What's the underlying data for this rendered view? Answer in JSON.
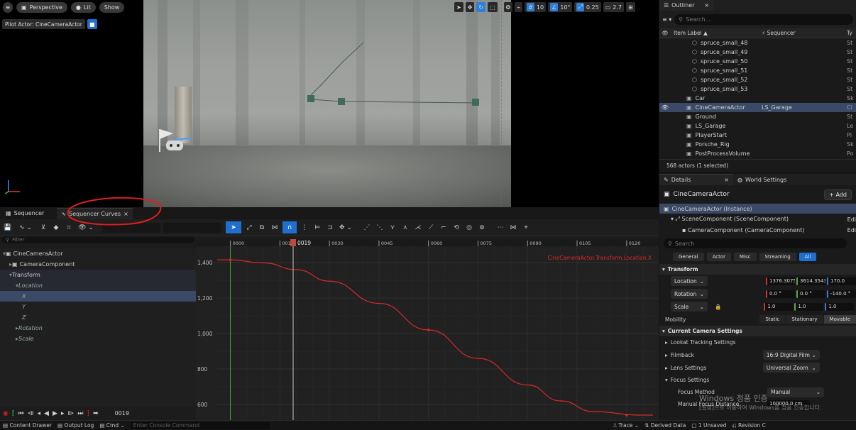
{
  "viewport": {
    "perspective_label": "Perspective",
    "lit_label": "Lit",
    "show_label": "Show",
    "pilot_label": "Pilot Actor: CineCameraActor",
    "grid_snap": "10",
    "rot_snap": "10°",
    "scale_snap": "0.25",
    "camera_speed": "2.7"
  },
  "outliner": {
    "tab_label": "Outliner",
    "search_placeholder": "Search...",
    "col_item_label": "Item Label ▲",
    "col_sequencer": "Sequencer",
    "col_type": "Ty",
    "items": [
      {
        "label": "spruce_small_48",
        "seq": "",
        "type": "St"
      },
      {
        "label": "spruce_small_49",
        "seq": "",
        "type": "St"
      },
      {
        "label": "spruce_small_50",
        "seq": "",
        "type": "St"
      },
      {
        "label": "spruce_small_51",
        "seq": "",
        "type": "St"
      },
      {
        "label": "spruce_small_52",
        "seq": "",
        "type": "St"
      },
      {
        "label": "spruce_small_53",
        "seq": "",
        "type": "St"
      },
      {
        "label": "Car",
        "seq": "",
        "type": "Sk"
      },
      {
        "label": "CineCameraActor",
        "seq": "LS_Garage",
        "type": "Ci"
      },
      {
        "label": "Ground",
        "seq": "",
        "type": "St"
      },
      {
        "label": "LS_Garage",
        "seq": "",
        "type": "Le"
      },
      {
        "label": "PlayerStart",
        "seq": "",
        "type": "Pl"
      },
      {
        "label": "Porsche_Rig",
        "seq": "",
        "type": "Sk"
      },
      {
        "label": "PostProcessVolume",
        "seq": "",
        "type": "Po"
      }
    ],
    "footer": "568 actors (1 selected)"
  },
  "details": {
    "tab_label": "Details",
    "world_settings_label": "World Settings",
    "actor_name": "CineCameraActor",
    "add_label": "+ Add",
    "instance_label": "CineCameraActor (Instance)",
    "scene_component": "SceneComponent (SceneComponent)",
    "camera_component": "CameraComponent (CameraComponent)",
    "edit_label": "Edi",
    "search_placeholder": "Search",
    "filters": [
      "General",
      "Actor",
      "Misc",
      "Streaming",
      "All"
    ],
    "transform_section": "Transform",
    "location_label": "Location",
    "location_values": [
      "1376.3075",
      "3614.3543",
      "170.0"
    ],
    "rotation_label": "Rotation",
    "rotation_values": [
      "0.0 °",
      "0.0 °",
      "-140.0 °"
    ],
    "scale_label": "Scale",
    "scale_values": [
      "1.0",
      "1.0",
      "1.0"
    ],
    "mobility_label": "Mobility",
    "mobility_options": [
      "Static",
      "Stationary",
      "Movable"
    ],
    "camera_section": "Current Camera Settings",
    "lookat": "Lookat Tracking Settings",
    "filmback_label": "Filmback",
    "filmback_value": "16:9 Digital Film",
    "lens_label": "Lens Settings",
    "lens_value": "Universal Zoom",
    "focus_section": "Focus Settings",
    "focus_method_label": "Focus Method",
    "focus_method_value": "Manual",
    "manual_focus_label": "Manual Focus Distance",
    "manual_focus_value": "100000.0 cm",
    "watermark_line1": "Windows 정품 인증",
    "watermark_line2": "[설정]으로 이동하여 Windows를 정품 인증합니다."
  },
  "sequencer": {
    "tab1": "Sequencer",
    "tab2": "Sequencer Curves",
    "filter_placeholder": "Filter",
    "tracks": [
      {
        "label": "CineCameraActor",
        "indent": 0,
        "selected": false
      },
      {
        "label": "CameraComponent",
        "indent": 1,
        "selected": false
      },
      {
        "label": "Transform",
        "indent": 1,
        "selected": false
      },
      {
        "label": "Location",
        "indent": 2,
        "selected": false
      },
      {
        "label": "X",
        "indent": 3,
        "selected": true
      },
      {
        "label": "Y",
        "indent": 3,
        "selected": false
      },
      {
        "label": "Z",
        "indent": 3,
        "selected": false
      },
      {
        "label": "Rotation",
        "indent": 2,
        "selected": false
      },
      {
        "label": "Scale",
        "indent": 2,
        "selected": false
      }
    ],
    "ruler_ticks": [
      "0000",
      "0015",
      "0030",
      "0045",
      "0060",
      "0075",
      "0090",
      "0105",
      "0120"
    ],
    "current_frame": "0019",
    "frame_display": "0019",
    "curve_name": "CineCameraActor.Transform.Location.X",
    "y_ticks": [
      "1,400",
      "1,200",
      "1,000",
      "800",
      "600"
    ]
  },
  "chart_data": {
    "type": "line",
    "title": "CineCameraActor.Transform.Location.X",
    "xlabel": "",
    "ylabel": "",
    "xlim": [
      -4,
      128
    ],
    "ylim": [
      520,
      1460
    ],
    "x_ticks": [
      0,
      15,
      30,
      45,
      60,
      75,
      90,
      105,
      120
    ],
    "y_ticks": [
      1400,
      1200,
      1000,
      800,
      600
    ],
    "series": [
      {
        "x": [
          0,
          10,
          20,
          30,
          45,
          60,
          75,
          90,
          100,
          110,
          124,
          128
        ],
        "y": [
          1415,
          1398,
          1360,
          1295,
          1170,
          1020,
          860,
          710,
          620,
          560,
          540,
          540
        ]
      }
    ],
    "keys": [
      {
        "x": 0,
        "y": 1415
      },
      {
        "x": 60,
        "y": 1020
      },
      {
        "x": 120,
        "y": 540
      }
    ],
    "color": "#d8282c",
    "grid": true
  },
  "status": {
    "content_drawer": "Content Drawer",
    "output_log": "Output Log",
    "cmd": "Cmd",
    "console_placeholder": "Enter Console Command",
    "trace": "Trace",
    "derived_data": "Derived Data",
    "unsaved": "1 Unsaved",
    "revision": "Revision C"
  }
}
